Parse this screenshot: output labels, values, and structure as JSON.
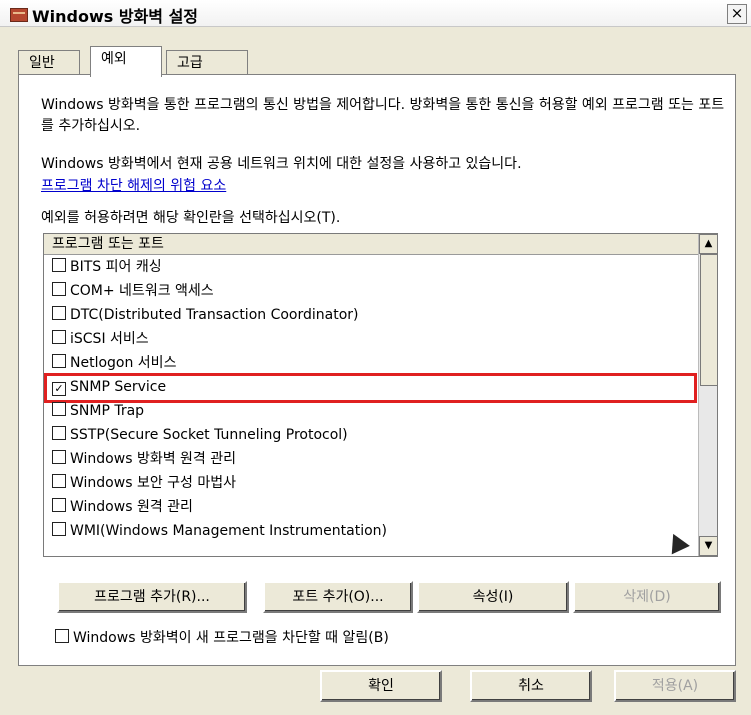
{
  "window": {
    "title": "Windows 방화벽 설정",
    "close_label": "×"
  },
  "tabs": [
    {
      "label": "일반"
    },
    {
      "label": "예외"
    },
    {
      "label": "고급"
    }
  ],
  "content": {
    "description": "Windows 방화벽을 통한 프로그램의 통신 방법을 제어합니다. 방화벽을 통한 통신을 허용할 예외 프로그램 또는 포트를 추가하십시오.",
    "status": "Windows 방화벽에서 현재 공용 네트워크 위치에 대한 설정을 사용하고 있습니다.",
    "risk_link": "프로그램 차단 해제의 위험 요소",
    "instruction": "예외를 허용하려면 해당 확인란을 선택하십시오(T)."
  },
  "list": {
    "header": "프로그램 또는 포트",
    "items": [
      {
        "label": "BITS 피어 캐싱",
        "checked": false
      },
      {
        "label": "COM+ 네트워크 액세스",
        "checked": false
      },
      {
        "label": "DTC(Distributed Transaction Coordinator)",
        "checked": false
      },
      {
        "label": "iSCSI 서비스",
        "checked": false
      },
      {
        "label": "Netlogon 서비스",
        "checked": false
      },
      {
        "label": "SNMP Service",
        "checked": true
      },
      {
        "label": "SNMP Trap",
        "checked": false
      },
      {
        "label": "SSTP(Secure Socket Tunneling Protocol)",
        "checked": false
      },
      {
        "label": "Windows 방화벽 원격 관리",
        "checked": false
      },
      {
        "label": "Windows 보안 구성 마법사",
        "checked": false
      },
      {
        "label": "Windows 원격 관리",
        "checked": false
      },
      {
        "label": "WMI(Windows Management Instrumentation)",
        "checked": false
      }
    ]
  },
  "buttons": {
    "add_program": "프로그램 추가(R)...",
    "add_port": "포트 추가(O)...",
    "properties": "속성(I)",
    "delete": "삭제(D)",
    "ok": "확인",
    "cancel": "취소",
    "apply": "적용(A)"
  },
  "notify": {
    "label": "Windows 방화벽이 새 프로그램을 차단할 때 알림(B)",
    "checked": false
  },
  "colors": {
    "highlight_border": "#e02020",
    "link": "#0000cc",
    "dialog_bg": "#ece9d8"
  }
}
